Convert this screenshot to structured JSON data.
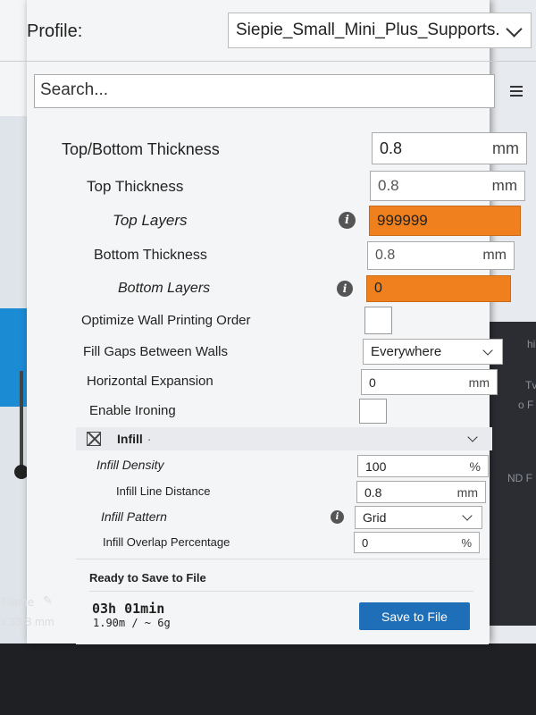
{
  "profile": {
    "label": "Profile:",
    "value": "Siepie_Small_Mini_Plus_Supports..."
  },
  "search": {
    "placeholder": "Search..."
  },
  "settings": {
    "top_bottom_thickness": {
      "label": "Top/Bottom Thickness",
      "value": "0.8",
      "unit": "mm"
    },
    "top_thickness": {
      "label": "Top Thickness",
      "value": "0.8",
      "unit": "mm"
    },
    "top_layers": {
      "label": "Top Layers",
      "value": "999999"
    },
    "bottom_thickness": {
      "label": "Bottom Thickness",
      "value": "0.8",
      "unit": "mm"
    },
    "bottom_layers": {
      "label": "Bottom Layers",
      "value": "0"
    },
    "optimize_wall": {
      "label": "Optimize Wall Printing Order"
    },
    "fill_gaps": {
      "label": "Fill Gaps Between Walls",
      "value": "Everywhere"
    },
    "horizontal_expansion": {
      "label": "Horizontal Expansion",
      "value": "0",
      "unit": "mm"
    },
    "enable_ironing": {
      "label": "Enable Ironing"
    }
  },
  "infill": {
    "category_label": "Infill",
    "density": {
      "label": "Infill Density",
      "value": "100",
      "unit": "%"
    },
    "line_distance": {
      "label": "Infill Line Distance",
      "value": "0.8",
      "unit": "mm"
    },
    "pattern": {
      "label": "Infill Pattern",
      "value": "Grid"
    },
    "overlap": {
      "label": "Infill Overlap Percentage",
      "value": "0",
      "unit": "%"
    }
  },
  "footer": {
    "status": "Ready to Save to File",
    "time": "03h 01min",
    "material": "1.90m / ~ 6g",
    "save_label": "Save to File"
  },
  "background": {
    "flame_label": "Flame",
    "dimension": "x 33.8 mm",
    "edge_hi": "hi",
    "edge_tv": "Tv",
    "edge_of": "o F",
    "edge_nd": "ND F"
  },
  "colors": {
    "accent_orange": "#f07f1d",
    "button_blue": "#1f6fb8",
    "app_blue": "#1b8bd4"
  }
}
